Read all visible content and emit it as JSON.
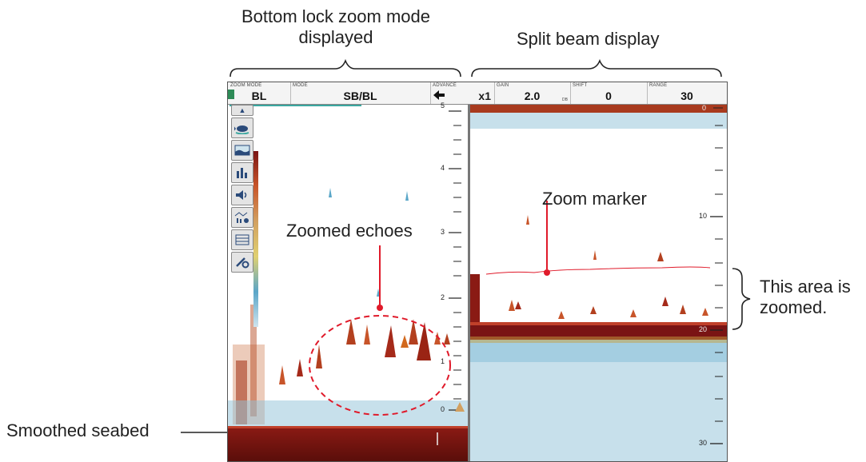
{
  "callouts": {
    "bottom_lock": "Bottom lock zoom mode displayed",
    "split_beam": "Split beam display",
    "zoom_marker": "Zoom marker",
    "zoomed_echoes": "Zoomed echoes",
    "area_zoomed": "This area is zoomed.",
    "smoothed_seabed": "Smoothed seabed"
  },
  "header": {
    "zoom_mode": {
      "label": "ZOOM MODE",
      "value": "BL"
    },
    "mode": {
      "label": "MODE",
      "value": "SB/BL"
    },
    "advance": {
      "label": "ADVANCE",
      "value": "x1",
      "icon": "arrow-left-icon"
    },
    "gain": {
      "label": "GAIN",
      "value": "2.0",
      "sub": "DB"
    },
    "shift": {
      "label": "SHIFT",
      "value": "0"
    },
    "range": {
      "label": "RANGE",
      "value": "30"
    }
  },
  "toolbar": {
    "icons": [
      "chevron-up-icon",
      "fish-icon",
      "seabed-icon",
      "bar-chart-icon",
      "speaker-icon",
      "histogram-icon",
      "layout-icon",
      "settings-icon"
    ]
  },
  "left_scale": {
    "labels": [
      "5",
      "4",
      "3",
      "2",
      "1",
      "0"
    ]
  },
  "right_scale": {
    "labels": [
      "0",
      "10",
      "20",
      "30"
    ]
  },
  "colors": {
    "seabed": "#7a1414",
    "echo_red": "#a52a1a",
    "echo_orange": "#d2691e",
    "noise_blue": "#5aa6c8",
    "marker_red": "#e01a2a",
    "teal": "#3aa7a0"
  }
}
